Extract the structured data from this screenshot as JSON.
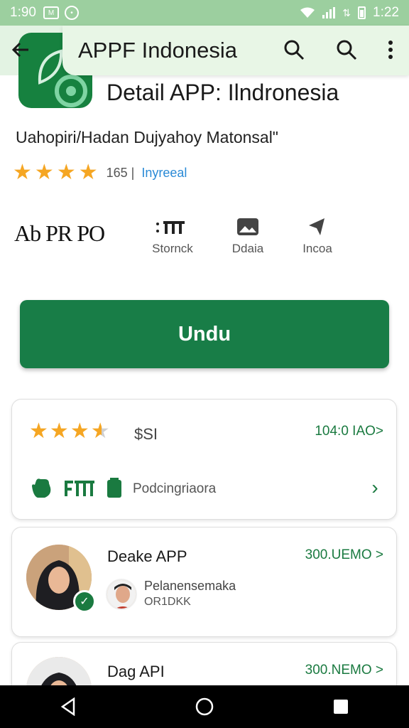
{
  "status_bar": {
    "time_left": "1:90",
    "time_right": "1:22"
  },
  "app_bar": {
    "title": "APPF Indonesia"
  },
  "detail": {
    "title": "Detail APP: Ilndronesia",
    "description": "Uahopiri/Hadan Dujyahoy Matonsal\"",
    "rating_count": "165 |",
    "category": "Inyreeal"
  },
  "meta": {
    "brand": "Ab PR PO",
    "items": [
      {
        "icon": "signal-bars-icon",
        "label": "Stornck"
      },
      {
        "icon": "image-icon",
        "label": "Ddaia"
      },
      {
        "icon": "arrow-icon",
        "label": "Incoa"
      }
    ]
  },
  "install": {
    "label": "Undu"
  },
  "rating_card": {
    "stars": 3.5,
    "price": "$SI",
    "link": "104:0 IAO>",
    "permissions": "Podcingriaora"
  },
  "developers": [
    {
      "name": "Deake APP",
      "price": "300.UEMO >",
      "sub1": "Pelanensemaka",
      "sub2": "OR1DKK"
    },
    {
      "name": "Dag API",
      "price": "300.NEMO >"
    }
  ],
  "colors": {
    "primary": "#187d47",
    "star": "#f5a623",
    "app_bar": "#e3f3e3",
    "status_bar": "#9ccf9f"
  }
}
